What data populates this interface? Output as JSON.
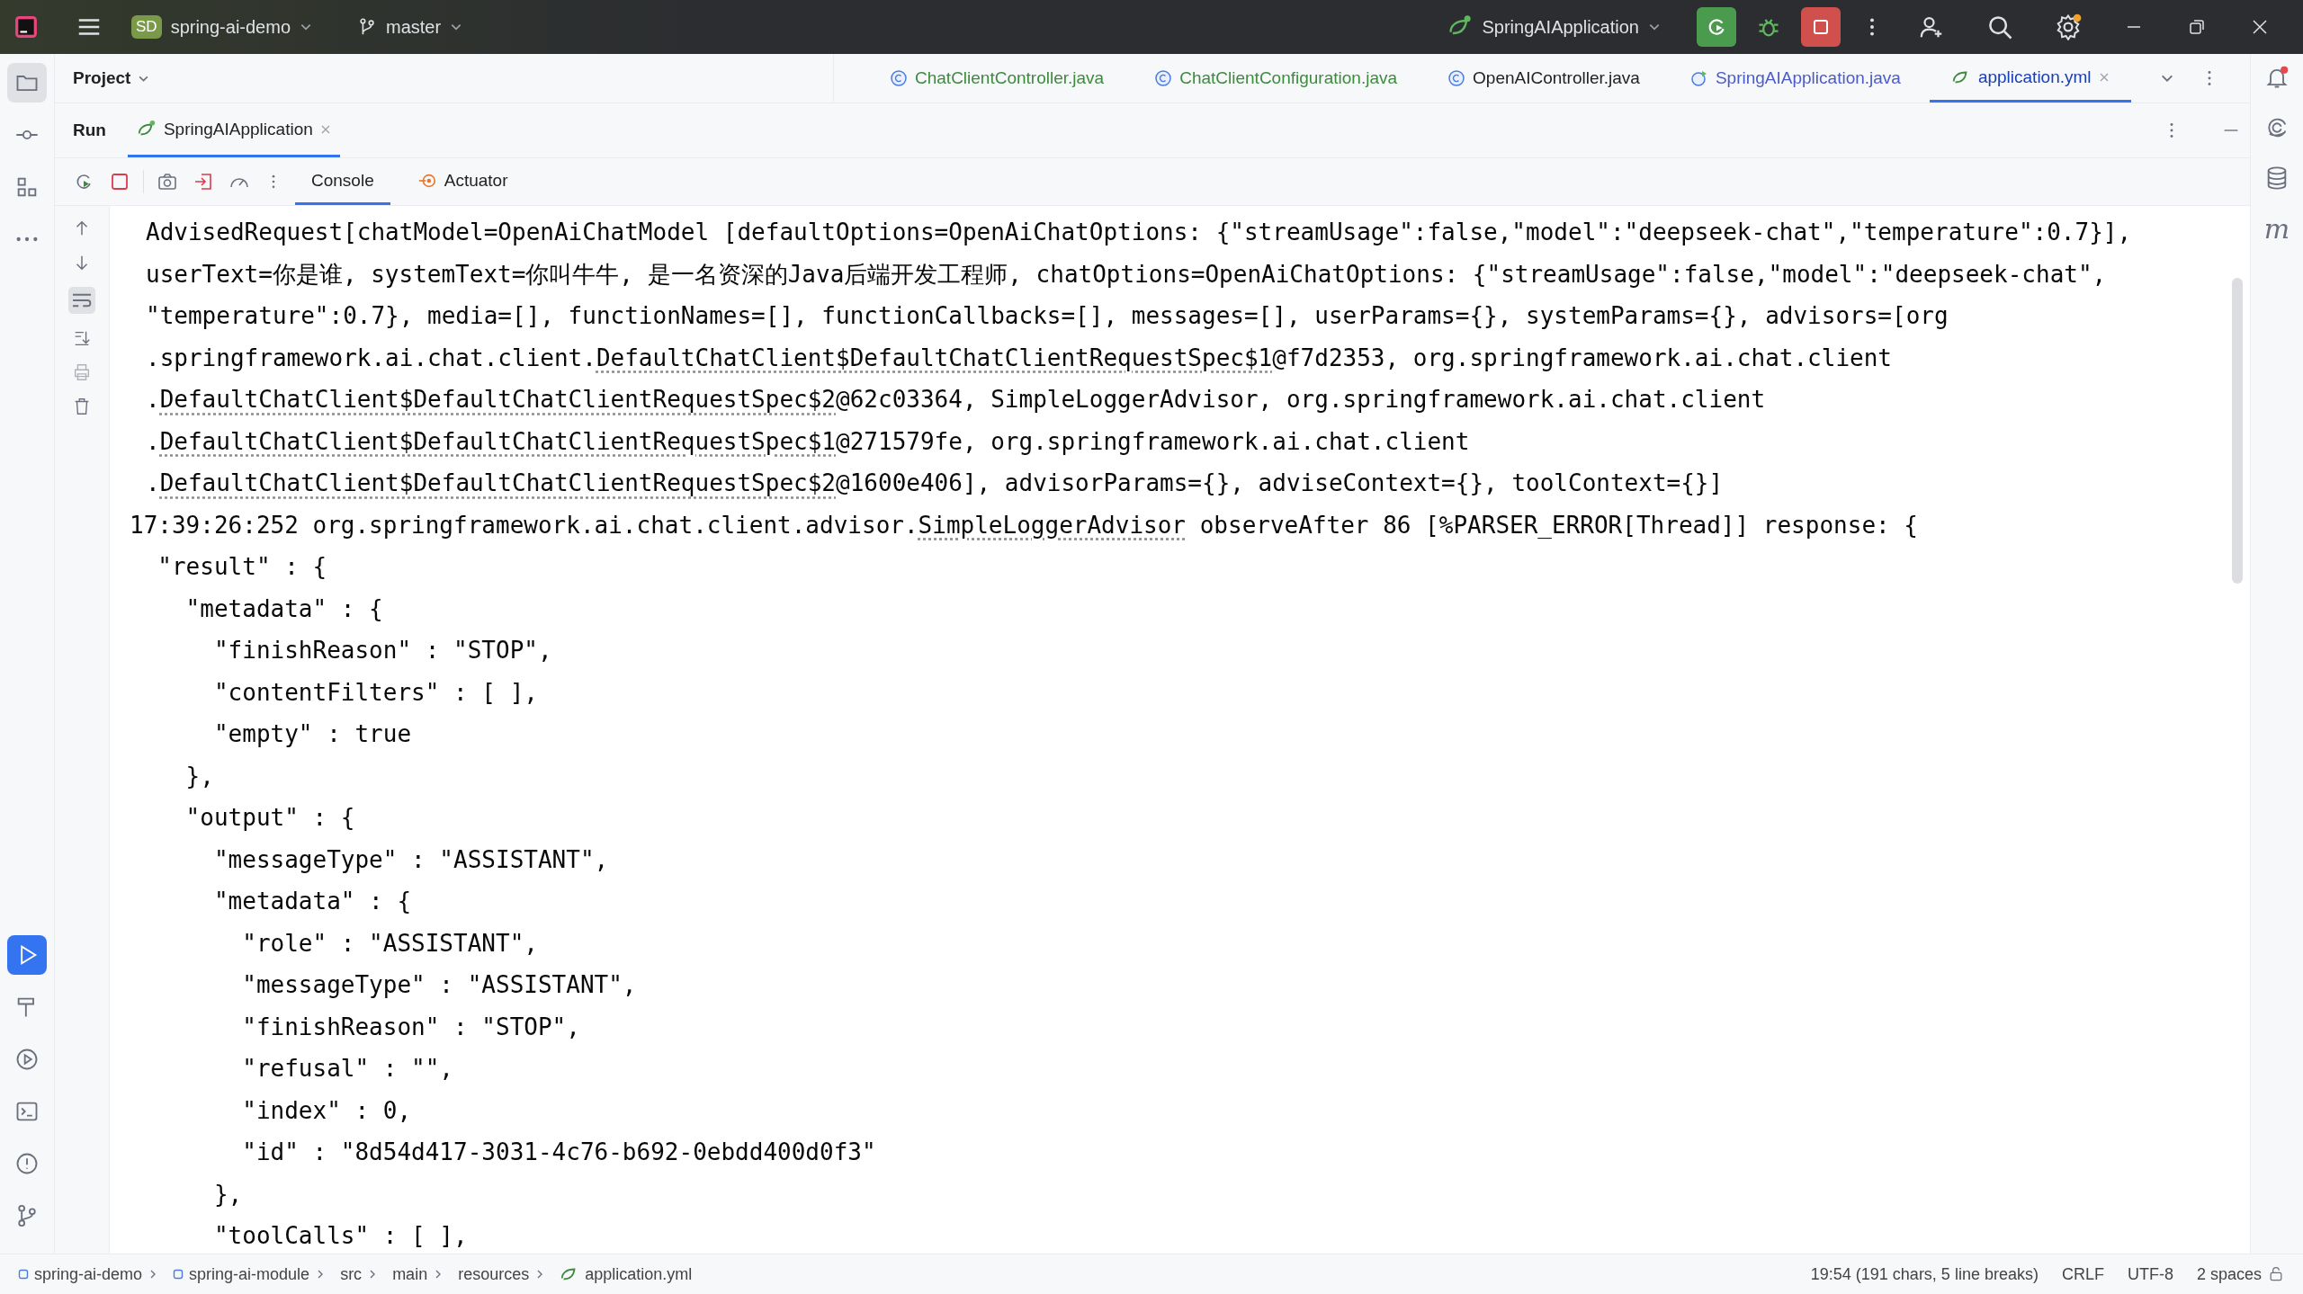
{
  "title_bar": {
    "project_badge": "SD",
    "project_name": "spring-ai-demo",
    "branch": "master",
    "run_config": "SpringAIApplication"
  },
  "left_toolbar": {
    "top": [
      {
        "kind": "folder",
        "selected": true
      },
      {
        "kind": "commit",
        "selected": false
      },
      {
        "kind": "structure",
        "selected": false
      },
      {
        "kind": "more",
        "selected": false
      }
    ],
    "bottom": [
      {
        "kind": "run",
        "selected": true
      },
      {
        "kind": "build",
        "selected": false
      },
      {
        "kind": "services",
        "selected": false
      },
      {
        "kind": "terminal",
        "selected": false
      },
      {
        "kind": "problems",
        "selected": false
      },
      {
        "kind": "git",
        "selected": false
      }
    ]
  },
  "right_toolbar": {
    "maven_glyph": "m"
  },
  "project_panel": {
    "title": "Project"
  },
  "editor_tabs": [
    {
      "label": "ChatClientController.java",
      "kind": "class",
      "color": "#3e8a3e",
      "selected": false
    },
    {
      "label": "ChatClientConfiguration.java",
      "kind": "class",
      "color": "#3e8a3e",
      "selected": false
    },
    {
      "label": "OpenAIController.java",
      "kind": "class",
      "color": "#222222",
      "selected": false
    },
    {
      "label": "SpringAIApplication.java",
      "kind": "app",
      "color": "#4a5bc8",
      "selected": false
    },
    {
      "label": "application.yml",
      "kind": "yml",
      "color": "#1a3fb0",
      "selected": true
    }
  ],
  "run_panel": {
    "title": "Run",
    "tabs": [
      {
        "label": "SpringAIApplication",
        "selected": true
      }
    ],
    "console_tabs": [
      {
        "label": "Console",
        "kind": "console",
        "selected": true
      },
      {
        "label": "Actuator",
        "kind": "actuator",
        "selected": false
      }
    ]
  },
  "console": {
    "lines": [
      {
        "kind": "cont",
        "parts": [
          {
            "text": "AdvisedRequest[chatModel=OpenAiChatModel [defaultOptions=OpenAiChatOptions: {\"streamUsage\":false,\"model\":\"deepseek-chat\",\"temperature\":0.7}],",
            "link": false
          }
        ]
      },
      {
        "kind": "cont",
        "parts": [
          {
            "text": "userText=你是谁, systemText=你叫牛牛, 是一名资深的Java后端开发工程师, chatOptions=OpenAiChatOptions: {\"streamUsage\":false,\"model\":\"deepseek-chat\",",
            "link": false
          }
        ]
      },
      {
        "kind": "cont",
        "parts": [
          {
            "text": "\"temperature\":0.7}, media=[], functionNames=[], functionCallbacks=[], messages=[], userParams={}, systemParams={}, advisors=[org",
            "link": false
          }
        ]
      },
      {
        "kind": "cont",
        "parts": [
          {
            "text": ".springframework.ai.chat.client.",
            "link": false
          },
          {
            "text": "DefaultChatClient$DefaultChatClientRequestSpec$1",
            "link": true
          },
          {
            "text": "@f7d2353, org.springframework.ai.chat.client",
            "link": false
          }
        ]
      },
      {
        "kind": "cont",
        "parts": [
          {
            "text": ".",
            "link": false
          },
          {
            "text": "DefaultChatClient$DefaultChatClientRequestSpec$2",
            "link": true
          },
          {
            "text": "@62c03364, SimpleLoggerAdvisor, org.springframework.ai.chat.client",
            "link": false
          }
        ]
      },
      {
        "kind": "cont",
        "parts": [
          {
            "text": ".",
            "link": false
          },
          {
            "text": "DefaultChatClient$DefaultChatClientRequestSpec$1",
            "link": true
          },
          {
            "text": "@271579fe, org.springframework.ai.chat.client",
            "link": false
          }
        ]
      },
      {
        "kind": "cont",
        "parts": [
          {
            "text": ".",
            "link": false
          },
          {
            "text": "DefaultChatClient$DefaultChatClientRequestSpec$2",
            "link": true
          },
          {
            "text": "@1600e406], advisorParams={}, adviseContext={}, toolContext={}]",
            "link": false
          }
        ]
      },
      {
        "kind": "line",
        "parts": [
          {
            "text": "17:39:26:252 org.springframework.ai.chat.client.advisor.",
            "link": false
          },
          {
            "text": "SimpleLoggerAdvisor",
            "link": true
          },
          {
            "text": " observeAfter 86 [%PARSER_ERROR[Thread]] response: {",
            "link": false
          }
        ]
      },
      {
        "kind": "line",
        "parts": [
          {
            "text": "  \"result\" : {",
            "link": false
          }
        ]
      },
      {
        "kind": "line",
        "parts": [
          {
            "text": "    \"metadata\" : {",
            "link": false
          }
        ]
      },
      {
        "kind": "line",
        "parts": [
          {
            "text": "      \"finishReason\" : \"STOP\",",
            "link": false
          }
        ]
      },
      {
        "kind": "line",
        "parts": [
          {
            "text": "      \"contentFilters\" : [ ],",
            "link": false
          }
        ]
      },
      {
        "kind": "line",
        "parts": [
          {
            "text": "      \"empty\" : true",
            "link": false
          }
        ]
      },
      {
        "kind": "line",
        "parts": [
          {
            "text": "    },",
            "link": false
          }
        ]
      },
      {
        "kind": "line",
        "parts": [
          {
            "text": "    \"output\" : {",
            "link": false
          }
        ]
      },
      {
        "kind": "line",
        "parts": [
          {
            "text": "      \"messageType\" : \"ASSISTANT\",",
            "link": false
          }
        ]
      },
      {
        "kind": "line",
        "parts": [
          {
            "text": "      \"metadata\" : {",
            "link": false
          }
        ]
      },
      {
        "kind": "line",
        "parts": [
          {
            "text": "        \"role\" : \"ASSISTANT\",",
            "link": false
          }
        ]
      },
      {
        "kind": "line",
        "parts": [
          {
            "text": "        \"messageType\" : \"ASSISTANT\",",
            "link": false
          }
        ]
      },
      {
        "kind": "line",
        "parts": [
          {
            "text": "        \"finishReason\" : \"STOP\",",
            "link": false
          }
        ]
      },
      {
        "kind": "line",
        "parts": [
          {
            "text": "        \"refusal\" : \"\",",
            "link": false
          }
        ]
      },
      {
        "kind": "line",
        "parts": [
          {
            "text": "        \"index\" : 0,",
            "link": false
          }
        ]
      },
      {
        "kind": "line",
        "parts": [
          {
            "text": "        \"id\" : \"8d54d417-3031-4c76-b692-0ebdd400d0f3\"",
            "link": false
          }
        ]
      },
      {
        "kind": "line",
        "parts": [
          {
            "text": "      },",
            "link": false
          }
        ]
      },
      {
        "kind": "line",
        "parts": [
          {
            "text": "      \"toolCalls\" : [ ],",
            "link": false
          }
        ]
      }
    ]
  },
  "status_bar": {
    "breadcrumbs": [
      {
        "label": "spring-ai-demo",
        "kind": "module"
      },
      {
        "label": "spring-ai-module",
        "kind": "module"
      },
      {
        "label": "src",
        "kind": "folder"
      },
      {
        "label": "main",
        "kind": "folder"
      },
      {
        "label": "resources",
        "kind": "folder"
      },
      {
        "label": "application.yml",
        "kind": "yml"
      }
    ],
    "info": [
      "19:54 (191 chars, 5 line breaks)",
      "CRLF",
      "UTF-8",
      "2 spaces"
    ]
  }
}
